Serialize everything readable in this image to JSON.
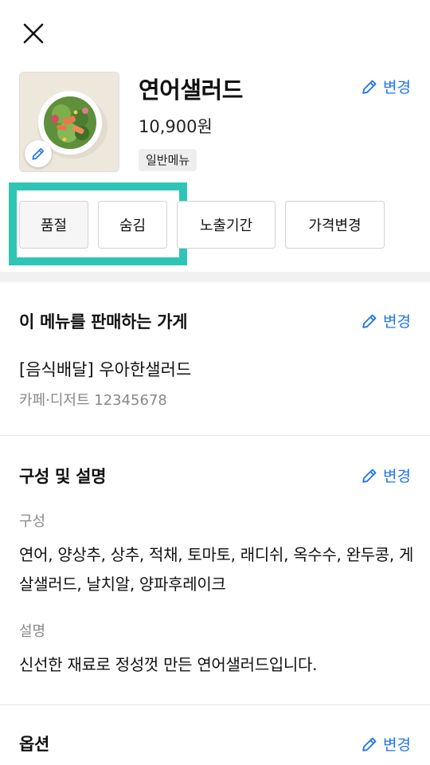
{
  "header": {
    "close_icon": "close-icon"
  },
  "item": {
    "name": "연어샐러드",
    "price": "10,900원",
    "badge": "일반메뉴",
    "image_icon": "salad-photo"
  },
  "edit_label": "변경",
  "status_buttons": [
    {
      "label": "품절",
      "active": true
    },
    {
      "label": "숨김",
      "active": false
    },
    {
      "label": "노출기간",
      "active": false
    },
    {
      "label": "가격변경",
      "active": false
    }
  ],
  "store_section": {
    "title": "이 메뉴를 판매하는 가게",
    "store_name": "[음식배달] 우아한샐러드",
    "store_meta": "카페·디저트 12345678"
  },
  "composition_section": {
    "title": "구성 및 설명",
    "composition_label": "구성",
    "composition_text": "연어, 양상추, 상추, 적채, 토마토, 래디쉬, 옥수수, 완두콩, 게살샐러드, 날치알, 양파후레이크",
    "description_label": "설명",
    "description_text": "신선한 재료로 정성껏 만든 연어샐러드입니다."
  },
  "options_section": {
    "title": "옵션"
  },
  "colors": {
    "accent": "#1e76e8",
    "highlight": "#2ec4b6"
  }
}
